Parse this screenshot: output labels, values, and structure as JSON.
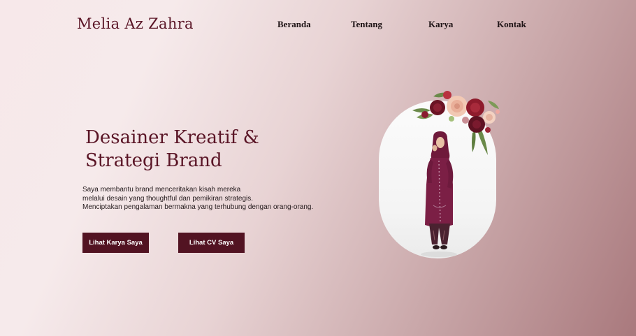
{
  "header": {
    "logo": "Melia Az Zahra",
    "nav": [
      {
        "label": "Beranda"
      },
      {
        "label": "Tentang"
      },
      {
        "label": "Karya"
      },
      {
        "label": "Kontak"
      }
    ]
  },
  "hero": {
    "title_lines": [
      "Desainer Kreatif &",
      "Strategi Brand"
    ],
    "description_lines": [
      "Saya membantu brand menceritakan kisah mereka",
      "melalui desain yang thoughtful dan pemikiran strategis.",
      "Menciptakan pengalaman bermakna yang terhubung dengan orang-orang."
    ],
    "primary_button": "Lihat Karya Saya",
    "secondary_button": "Lihat CV Saya"
  },
  "colors": {
    "brand": "#5a1526",
    "button": "#521322",
    "dress": "#7b1f45",
    "background_start": "#f7e8ea",
    "background_end": "#a9797d"
  },
  "icons": {
    "flowers": "floral-bouquet-decoration",
    "portrait": "woman-in-maroon-kebaya-photo"
  }
}
